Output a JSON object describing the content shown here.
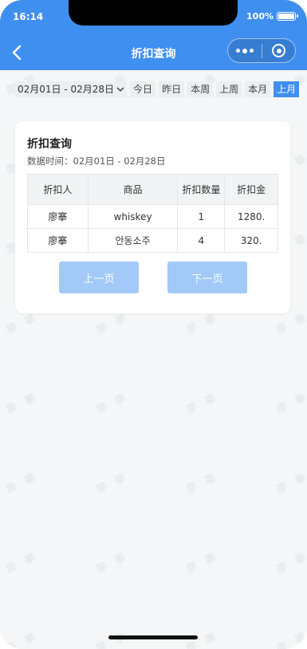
{
  "status_bar": {
    "time": "16:14",
    "battery": "100%"
  },
  "nav": {
    "title": "折扣查询"
  },
  "filters": {
    "date_range": "02月01日 - 02月28日",
    "chips": [
      {
        "label": "今日",
        "active": false
      },
      {
        "label": "昨日",
        "active": false
      },
      {
        "label": "本周",
        "active": false
      },
      {
        "label": "上周",
        "active": false
      },
      {
        "label": "本月",
        "active": false
      },
      {
        "label": "上月",
        "active": true
      }
    ]
  },
  "card": {
    "title": "折扣查询",
    "subtitle": "数据时间：02月01日 - 02月28日",
    "table": {
      "headers": [
        "折扣人",
        "商品",
        "折扣数量",
        "折扣金"
      ],
      "rows": [
        [
          "廖搴",
          "whiskey",
          "1",
          "1280."
        ],
        [
          "廖搴",
          "안동소주",
          "4",
          "320."
        ]
      ]
    },
    "pager": {
      "prev": "上一页",
      "next": "下一页"
    }
  },
  "watermark": "廖 搴",
  "colors": {
    "primary": "#3f8ff0",
    "pager_disabled": "#a2c9f7",
    "background": "#f5f6f7"
  }
}
